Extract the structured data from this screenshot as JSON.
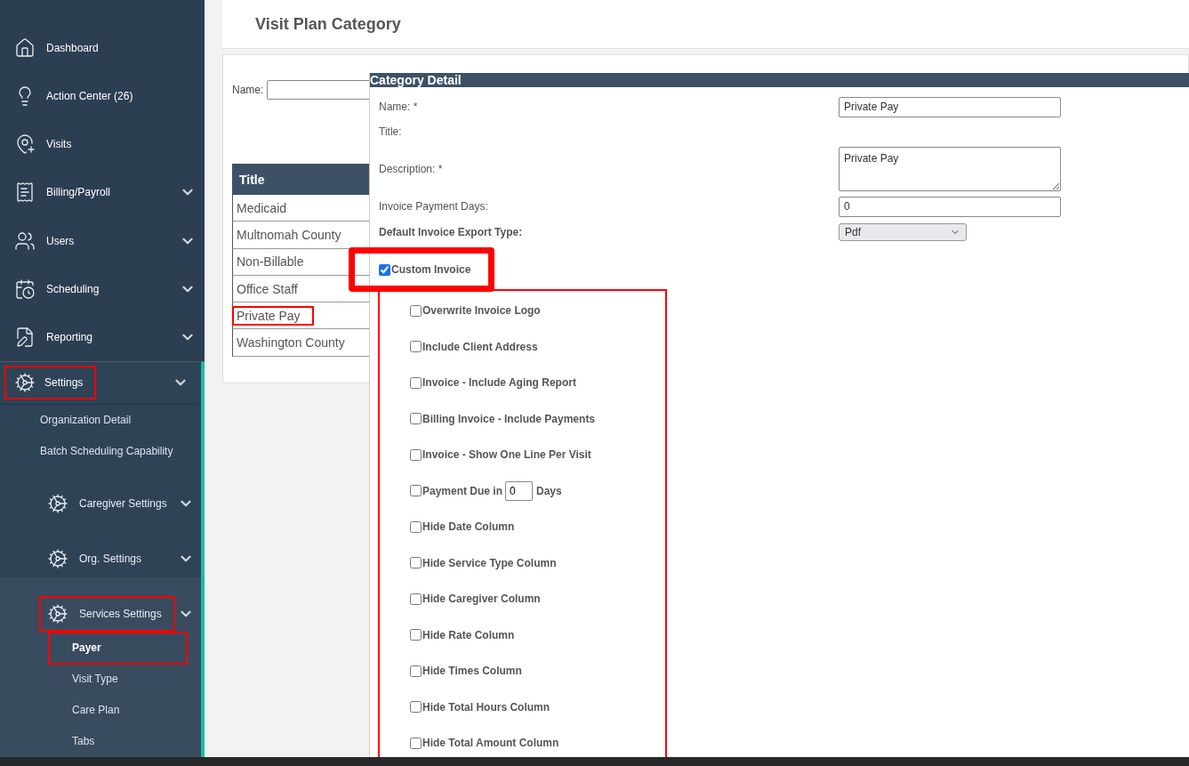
{
  "sidebar": {
    "items": [
      {
        "label": "Dashboard",
        "expandable": false
      },
      {
        "label": "Action Center (26)",
        "expandable": false
      },
      {
        "label": "Visits",
        "expandable": false
      },
      {
        "label": "Billing/Payroll",
        "expandable": true
      },
      {
        "label": "Users",
        "expandable": true
      },
      {
        "label": "Scheduling",
        "expandable": true
      },
      {
        "label": "Reporting",
        "expandable": true
      }
    ],
    "settings": {
      "label": "Settings",
      "expandable": true,
      "highlighted": true,
      "children": [
        {
          "kind": "link",
          "label": "Organization Detail"
        },
        {
          "kind": "link",
          "label": "Batch Scheduling Capability"
        },
        {
          "kind": "group",
          "label": "Caregiver Settings",
          "highlighted": false
        },
        {
          "kind": "group",
          "label": "Org. Settings",
          "highlighted": false
        },
        {
          "kind": "group",
          "label": "Services Settings",
          "highlighted": true,
          "children": [
            {
              "label": "Payer",
              "selected": true,
              "highlighted": true
            },
            {
              "label": "Visit Type",
              "selected": false,
              "highlighted": false
            },
            {
              "label": "Care Plan",
              "selected": false,
              "highlighted": false
            },
            {
              "label": "Tabs",
              "selected": false,
              "highlighted": false
            }
          ]
        }
      ]
    }
  },
  "page": {
    "title": "Visit Plan Category"
  },
  "filter": {
    "label": "Name:"
  },
  "table": {
    "columns": [
      "Title"
    ],
    "rows": [
      {
        "title": "Medicaid",
        "highlighted": false
      },
      {
        "title": "Multnomah County",
        "highlighted": false
      },
      {
        "title": "Non-Billable",
        "highlighted": false
      },
      {
        "title": "Office Staff",
        "highlighted": false
      },
      {
        "title": "Private Pay",
        "highlighted": true
      },
      {
        "title": "Washington County",
        "highlighted": false
      }
    ]
  },
  "detail": {
    "title": "Category Detail",
    "fields": [
      {
        "kind": "text",
        "label": "Name: *",
        "value": "Private Pay"
      },
      {
        "kind": "label",
        "label": "Title:"
      },
      {
        "kind": "textarea",
        "label": "Description: *",
        "value": "Private Pay"
      },
      {
        "kind": "text",
        "label": "Invoice Payment Days:",
        "value": "0"
      },
      {
        "kind": "select",
        "label": "Default Invoice Export Type:",
        "value": "Pdf"
      }
    ],
    "custom_invoice": {
      "label": "Custom Invoice",
      "checked": true,
      "highlighted": true
    },
    "options_highlighted": true,
    "options": [
      {
        "kind": "check",
        "label": "Overwrite Invoice Logo",
        "checked": false
      },
      {
        "kind": "check",
        "label": "Include Client Address",
        "checked": false
      },
      {
        "kind": "check",
        "label": "Invoice - Include Aging Report",
        "checked": false
      },
      {
        "kind": "check",
        "label": "Billing Invoice - Include Payments",
        "checked": false
      },
      {
        "kind": "check",
        "label": "Invoice - Show One Line Per Visit",
        "checked": false
      },
      {
        "kind": "days",
        "label": "Payment Due in",
        "value": "0",
        "suffix": "Days",
        "checked": false
      },
      {
        "kind": "check",
        "label": "Hide Date Column",
        "checked": false
      },
      {
        "kind": "check",
        "label": "Hide Service Type Column",
        "checked": false
      },
      {
        "kind": "check",
        "label": "Hide Caregiver Column",
        "checked": false
      },
      {
        "kind": "check",
        "label": "Hide Rate Column",
        "checked": false
      },
      {
        "kind": "check",
        "label": "Hide Times Column",
        "checked": false
      },
      {
        "kind": "check",
        "label": "Hide Total Hours Column",
        "checked": false
      },
      {
        "kind": "check",
        "label": "Hide Total Amount Column",
        "checked": false
      }
    ]
  }
}
